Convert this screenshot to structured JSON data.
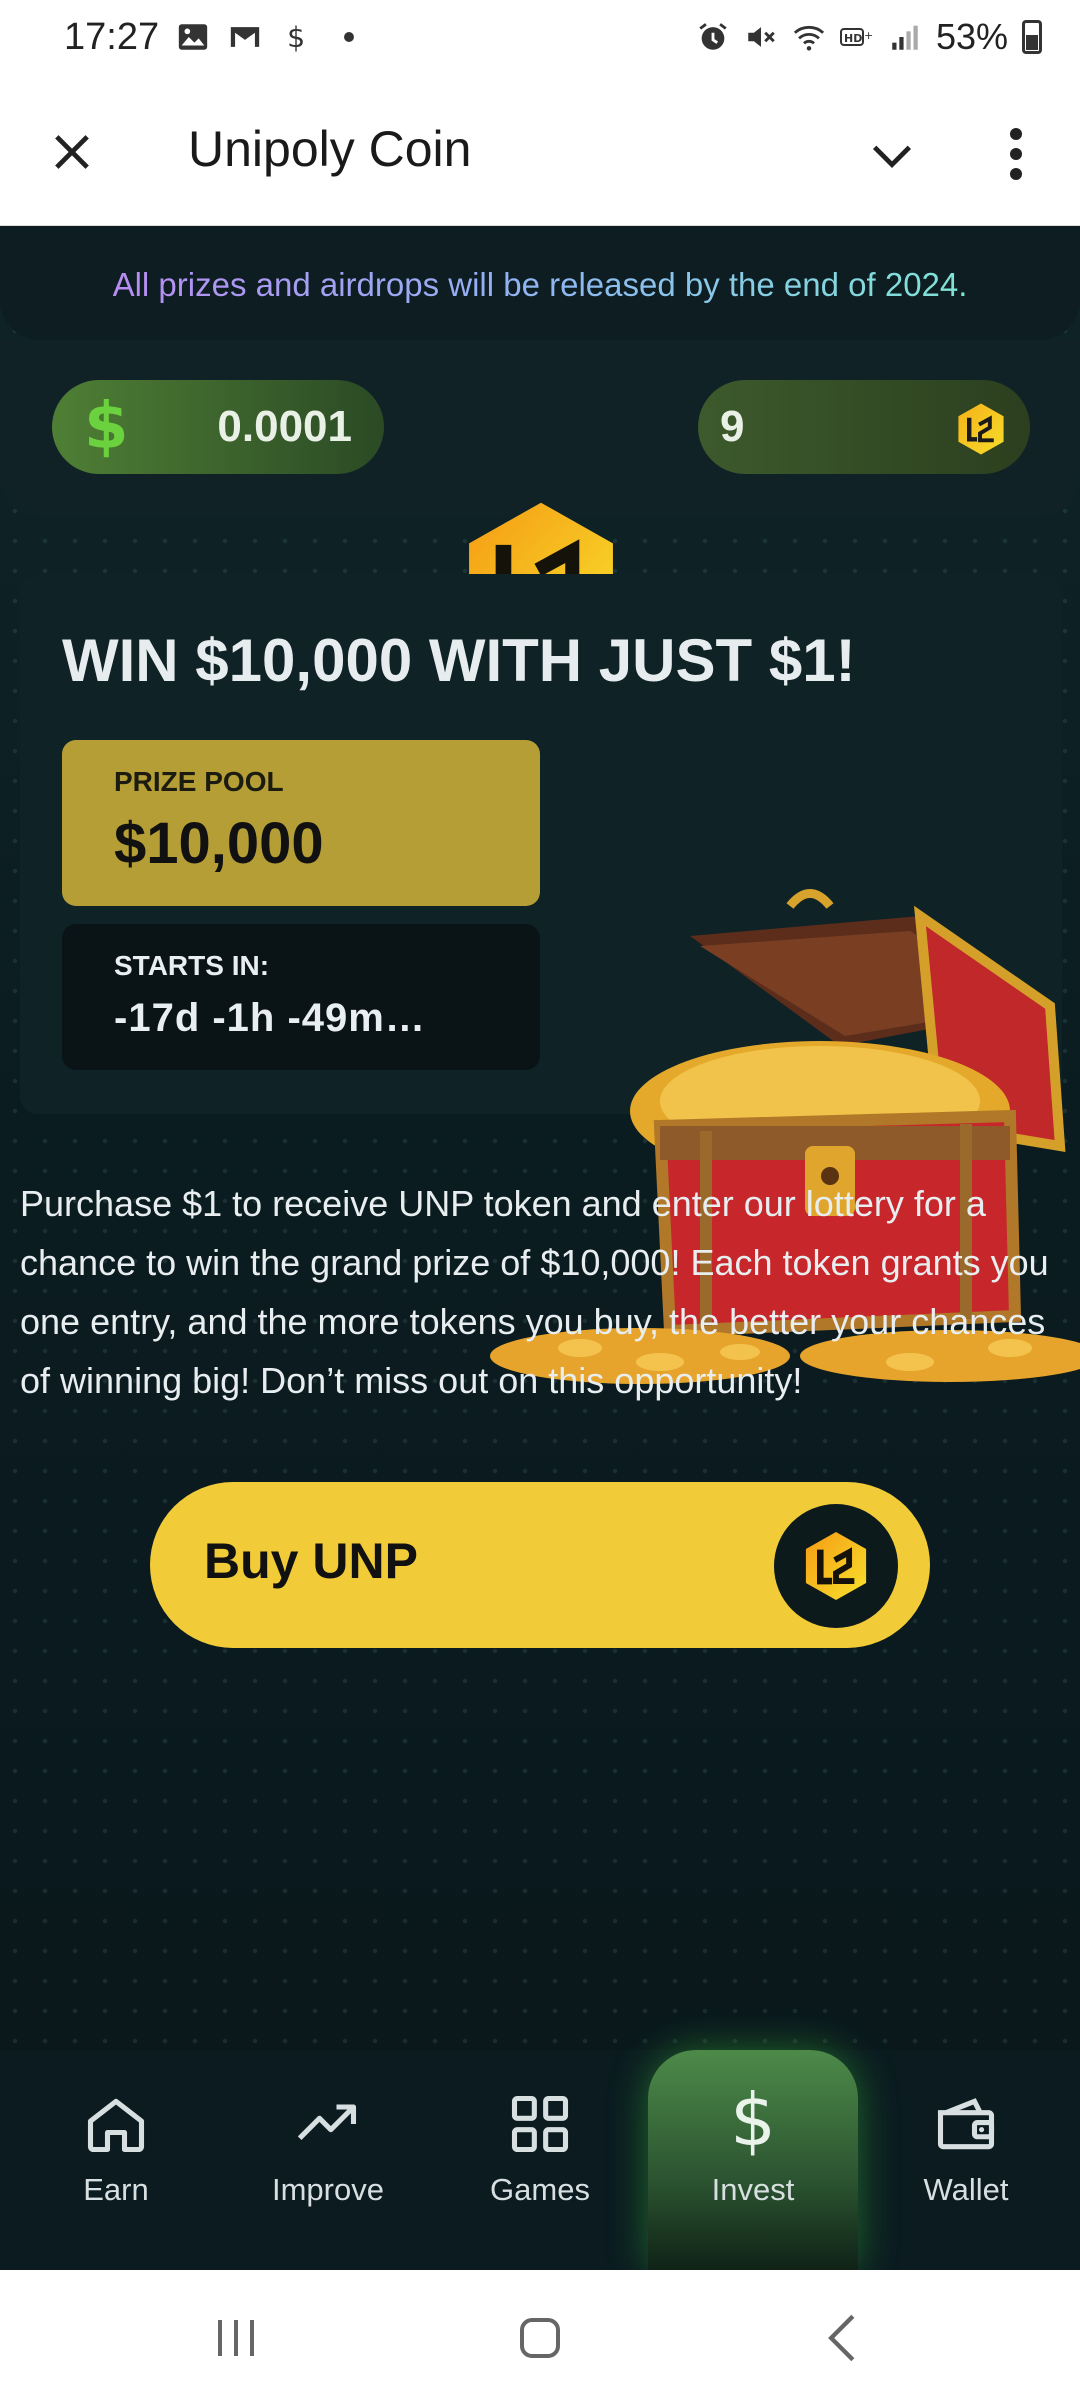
{
  "status_bar": {
    "time": "17:27",
    "battery": "53%"
  },
  "app_bar": {
    "title": "Unipoly Coin"
  },
  "notice": "All prizes and airdrops will be released by the end of 2024.",
  "balances": {
    "usd_symbol": "$",
    "usd_value": "0.0001",
    "coin_value": "9"
  },
  "promo": {
    "headline": "WIN $10,000 WITH JUST $1!",
    "prize_pool_label": "PRIZE POOL",
    "prize_pool_amount": "$10,000",
    "starts_in_label": "STARTS IN:",
    "countdown": "-17d -1h -49m…"
  },
  "description": "Purchase $1 to receive UNP token and enter our lottery for a chance to win the grand prize of $10,000! Each token grants you one entry, and the more tokens you buy, the better your chances of winning big! Don’t miss out on this opportunity!",
  "buy_button": {
    "label": "Buy UNP"
  },
  "bottom_nav": {
    "items": [
      {
        "label": "Earn",
        "icon": "home-icon"
      },
      {
        "label": "Improve",
        "icon": "trending-up-icon"
      },
      {
        "label": "Games",
        "icon": "grid-icon"
      },
      {
        "label": "Invest",
        "icon": "dollar-icon",
        "active": true
      },
      {
        "label": "Wallet",
        "icon": "wallet-icon"
      }
    ]
  },
  "colors": {
    "accent_yellow": "#f2cc38",
    "prize_gold": "#b49e35",
    "active_green": "#4d8a49",
    "background": "#0c1a1d"
  }
}
